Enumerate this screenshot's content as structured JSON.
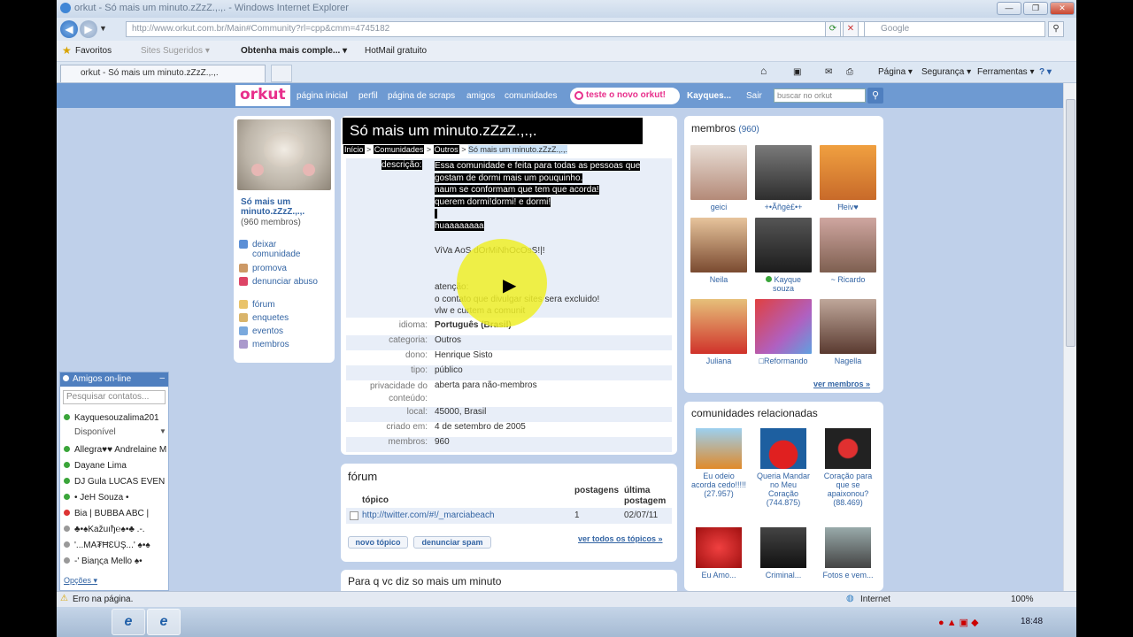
{
  "window": {
    "title": "orkut - Só mais um minuto.zZzZ.,.,. - Windows Internet Explorer"
  },
  "address": {
    "url": "http://www.orkut.com.br/Main#Community?rl=cpp&cmm=4745182",
    "search_placeholder": "Google"
  },
  "favbar": {
    "favoritos": "Favoritos",
    "sites": "Sites Sugeridos ▾",
    "obtenha": "Obtenha mais comple... ▾",
    "hotmail": "HotMail gratuito"
  },
  "tab": {
    "label": "orkut - Só mais um minuto.zZzZ.,.,."
  },
  "cmdbar": {
    "pagina": "Página ▾",
    "seguranca": "Segurança ▾",
    "ferramentas": "Ferramentas ▾",
    "help": "? ▾"
  },
  "topnav": {
    "logo": "orkut",
    "home": "página inicial",
    "perfil": "perfil",
    "scraps": "página de scraps",
    "amigos": "amigos",
    "comunidades": "comunidades",
    "teste": "teste o novo orkut!",
    "user": "Kayques...",
    "sair": "Sair",
    "search_placeholder": "buscar no orkut"
  },
  "left": {
    "name": "Só mais um minuto.zZzZ.,.,.",
    "count": "(960 membros)",
    "menu1": [
      "deixar comunidade",
      "promova",
      "denunciar abuso"
    ],
    "menu2": [
      "fórum",
      "enquetes",
      "eventos",
      "membros"
    ]
  },
  "friends": {
    "title": "Amigos on-line",
    "search_placeholder": "Pesquisar contatos...",
    "self": "Kayquesouzalima201",
    "status": "Disponível",
    "list": [
      "Allegra♥♥ Andrelaine M",
      "Dayane Lima",
      "DJ Gula LUCAS EVEN",
      "• JeH Souza •",
      "Bia | BUBBA ABC |",
      "♣•♠Kažuıђ℮♠•♣ .-.",
      "'...MA₮ĦƐÜŞ...' ♠•♠",
      "-' Biaηςa Mello ♠•"
    ],
    "options": "Opções ▾"
  },
  "community": {
    "title": "Só mais um minuto.zZzZ.,.,.",
    "breadcrumb": [
      "Início",
      ">",
      "Comunidades",
      ">",
      "Outros",
      ">",
      "Só mais um minuto.zZzZ.,.,."
    ],
    "desc_label": "descrição:",
    "desc_lines": [
      "Essa comunidade e feita para todas as pessoas que",
      "gostam de dormi mais um pouquinho.",
      "naum se conformam que tem que acorda!",
      "querem dormi!dormi! e dormi!"
    ],
    "desc_huaa": "huaaaaaaaa",
    "desc_viva": "ViVa AoS dOrMiNhOcOsS!|!",
    "desc_atencao": "atenção:",
    "desc_contato": "o contato que divulgar sites sera excluido!",
    "desc_vlw": "vlw e curtem a comunit",
    "fields": [
      {
        "k": "idioma:",
        "v": "Português (Brasil)"
      },
      {
        "k": "categoria:",
        "v": "Outros"
      },
      {
        "k": "dono:",
        "v": "Henrique Sisto"
      },
      {
        "k": "tipo:",
        "v": "público"
      },
      {
        "k": "privacidade do conteúdo:",
        "v": "aberta para não-membros"
      },
      {
        "k": "local:",
        "v": "45000, Brasil"
      },
      {
        "k": "criado em:",
        "v": "4 de setembro de 2005"
      },
      {
        "k": "membros:",
        "v": "960"
      }
    ]
  },
  "forum": {
    "title": "fórum",
    "col_topic": "tópico",
    "col_posts": "postagens",
    "col_last": "última postagem",
    "row": {
      "topic": "http://twitter.com/#!/_marciabeach",
      "posts": "1",
      "last": "02/07/11"
    },
    "new_topic": "novo tópico",
    "spam": "denunciar spam",
    "all": "ver todos os tópicos »"
  },
  "next_section": {
    "title": "Para q vc diz so mais um minuto"
  },
  "members": {
    "title": "membros",
    "count": "(960)",
    "list": [
      "geici",
      "+•Ãñgè£•+",
      "Ħeiv♥",
      "Neila",
      "Kayque souza",
      "~ Ricardo",
      "Juliana",
      "□Reformando",
      "Nagella"
    ],
    "more": "ver membros »"
  },
  "related": {
    "title": "comunidades relacionadas",
    "list": [
      "Eu odeio acorda cedo!!!!! (27.957)",
      "Queria Mandar no Meu Coração (744.875)",
      "Coração para que se apaixonou? (88.469)",
      "Eu Amo...",
      "Criminal...",
      "Fotos e vem..."
    ]
  },
  "status": {
    "text": "Erro na página.",
    "zone": "Internet",
    "zoom": "100%"
  },
  "taskbar": {
    "time": "18:48"
  }
}
